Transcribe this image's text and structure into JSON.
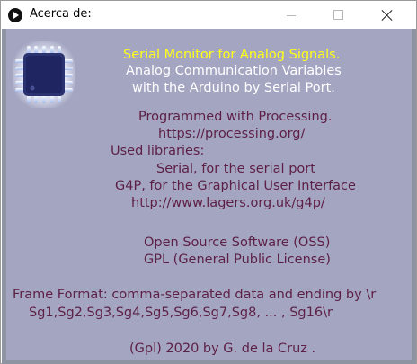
{
  "window": {
    "title": "Acerca de:",
    "icons": {
      "app": "processing-play-icon",
      "minimize": "minimize-icon",
      "maximize": "maximize-icon",
      "close": "close-icon"
    }
  },
  "about": {
    "logo_icon": "microchip-icon",
    "heading": "Serial Monitor for Analog Signals.",
    "subtitle_line1": "Analog Communication Variables",
    "subtitle_line2": "with the Arduino by Serial Port.",
    "programmed_with": "Programmed with Processing.",
    "processing_url": "https://processing.org/",
    "used_libraries": "Used libraries:",
    "lib_serial": "Serial, for the serial port",
    "lib_g4p": "G4P, for the Graphical User Interface",
    "g4p_url": "http://www.lagers.org.uk/g4p/",
    "oss": "Open Source Software (OSS)",
    "gpl": "GPL (General Public License)",
    "frame_format": "Frame Format: comma-separated data and ending by \\r",
    "frame_example": "Sg1,Sg2,Sg3,Sg4,Sg5,Sg6,Sg7,Sg8, ... , Sg16\\r",
    "copyright": "(Gpl) 2020 by G. de la Cruz ."
  },
  "colors": {
    "background": "#a4a5c1",
    "heading": "#ffff1a",
    "subtitle": "#ffffff",
    "body_text": "#5c1f45"
  }
}
